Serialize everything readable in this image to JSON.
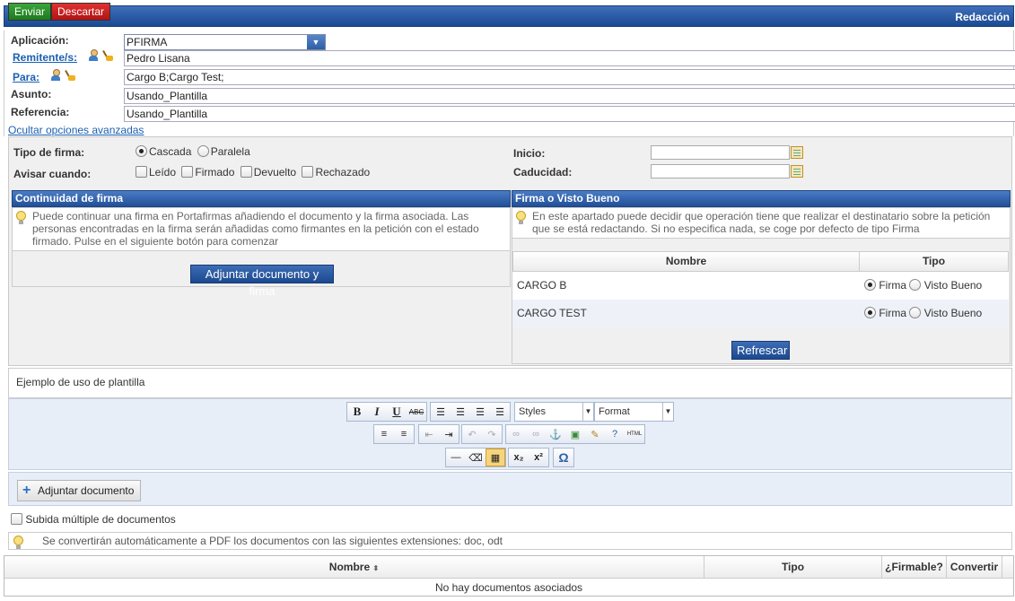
{
  "toolbar": {
    "send_label": "Enviar",
    "discard_label": "Descartar",
    "title": "Redacción"
  },
  "form": {
    "app_label": "Aplicación:",
    "app_value": "PFIRMA",
    "senders_label": "Remitente/s:",
    "senders_value": "Pedro Lisana",
    "to_label": "Para:",
    "to_value": "Cargo B;Cargo Test;",
    "subject_label": "Asunto:",
    "subject_value": "Usando_Plantilla",
    "reference_label": "Referencia:",
    "reference_value": "Usando_Plantilla",
    "advanced_link": "Ocultar opciones avanzadas"
  },
  "options": {
    "sign_type_label": "Tipo de firma:",
    "cascade": "Cascada",
    "parallel": "Paralela",
    "notify_label": "Avisar cuando:",
    "read": "Leído",
    "signed": "Firmado",
    "returned": "Devuelto",
    "rejected": "Rechazado",
    "start_label": "Inicio:",
    "expiry_label": "Caducidad:"
  },
  "continuity": {
    "title": "Continuidad de firma",
    "tip": "Puede continuar una firma en Portafirmas añadiendo el documento y la firma asociada. Las personas encontradas en la firma serán añadidas como firmantes en la petición con el estado firmado. Pulse en el siguiente botón para comenzar",
    "button": "Adjuntar documento y firma"
  },
  "approval": {
    "title": "Firma o Visto Bueno",
    "tip": "En este apartado puede decidir que operación tiene que realizar el destinatario sobre la petición que se está redactando. Si no especifica nada, se coge por defecto de tipo Firma",
    "col_name": "Nombre",
    "col_type": "Tipo",
    "rows": [
      {
        "name": "CARGO B",
        "opt1": "Firma",
        "opt2": "Visto Bueno"
      },
      {
        "name": "CARGO TEST",
        "opt1": "Firma",
        "opt2": "Visto Bueno"
      }
    ],
    "refresh": "Refrescar"
  },
  "editor": {
    "body": "Ejemplo de uso de plantilla",
    "styles": "Styles",
    "format": "Format",
    "btn_bold": "B",
    "btn_italic": "I",
    "btn_underline": "U",
    "btn_strike": "ABC",
    "btn_html": "HTML",
    "btn_omega": "Ω"
  },
  "attach": {
    "button": "Adjuntar documento",
    "multi": "Subida múltiple de documentos",
    "convert_tip": "Se convertirán automáticamente a PDF los documentos con las siguientes extensiones: doc, odt"
  },
  "docs": {
    "col_name": "Nombre",
    "col_type": "Tipo",
    "col_signable": "¿Firmable?",
    "col_convert": "Convertir",
    "empty": "No hay documentos asociados"
  }
}
